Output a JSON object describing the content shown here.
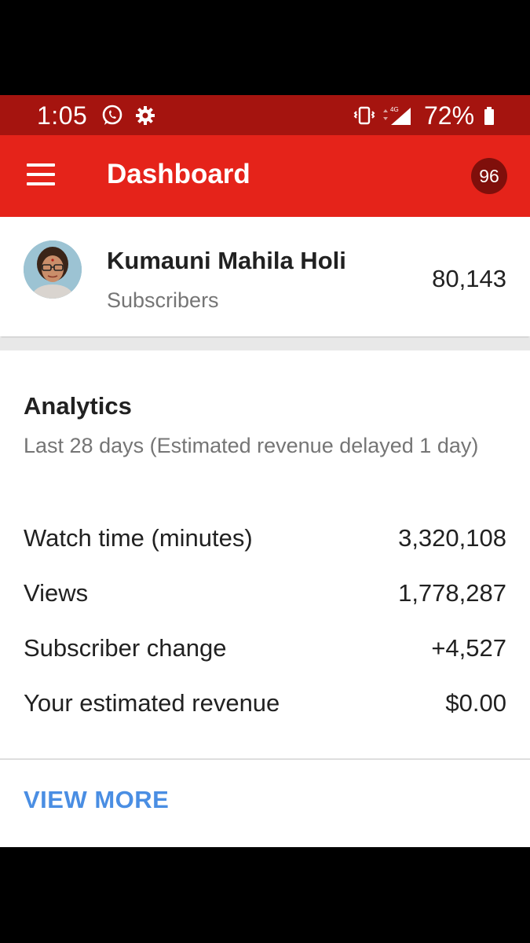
{
  "status_bar": {
    "time": "1:05",
    "battery": "72%",
    "icons": [
      "whatsapp-icon",
      "settings-gear-icon",
      "vibrate-icon",
      "4g-signal-icon",
      "battery-icon"
    ],
    "network_label": "4G"
  },
  "app_bar": {
    "title": "Dashboard",
    "notification_count": "96",
    "menu_icon": "hamburger-menu-icon"
  },
  "channel": {
    "name": "Kumauni Mahila Holi",
    "subscribers_label": "Subscribers",
    "subscriber_count": "80,143"
  },
  "analytics": {
    "title": "Analytics",
    "subtitle": "Last 28 days (Estimated revenue delayed 1 day)",
    "metrics": [
      {
        "label": "Watch time (minutes)",
        "value": "3,320,108"
      },
      {
        "label": "Views",
        "value": "1,778,287"
      },
      {
        "label": "Subscriber change",
        "value": "+4,527"
      },
      {
        "label": "Your estimated revenue",
        "value": "$0.00"
      }
    ],
    "view_more_label": "VIEW MORE"
  },
  "colors": {
    "status_bar": "#a5140f",
    "app_bar": "#e5231a",
    "badge": "#7f0f0b",
    "link": "#4a8ee3"
  }
}
